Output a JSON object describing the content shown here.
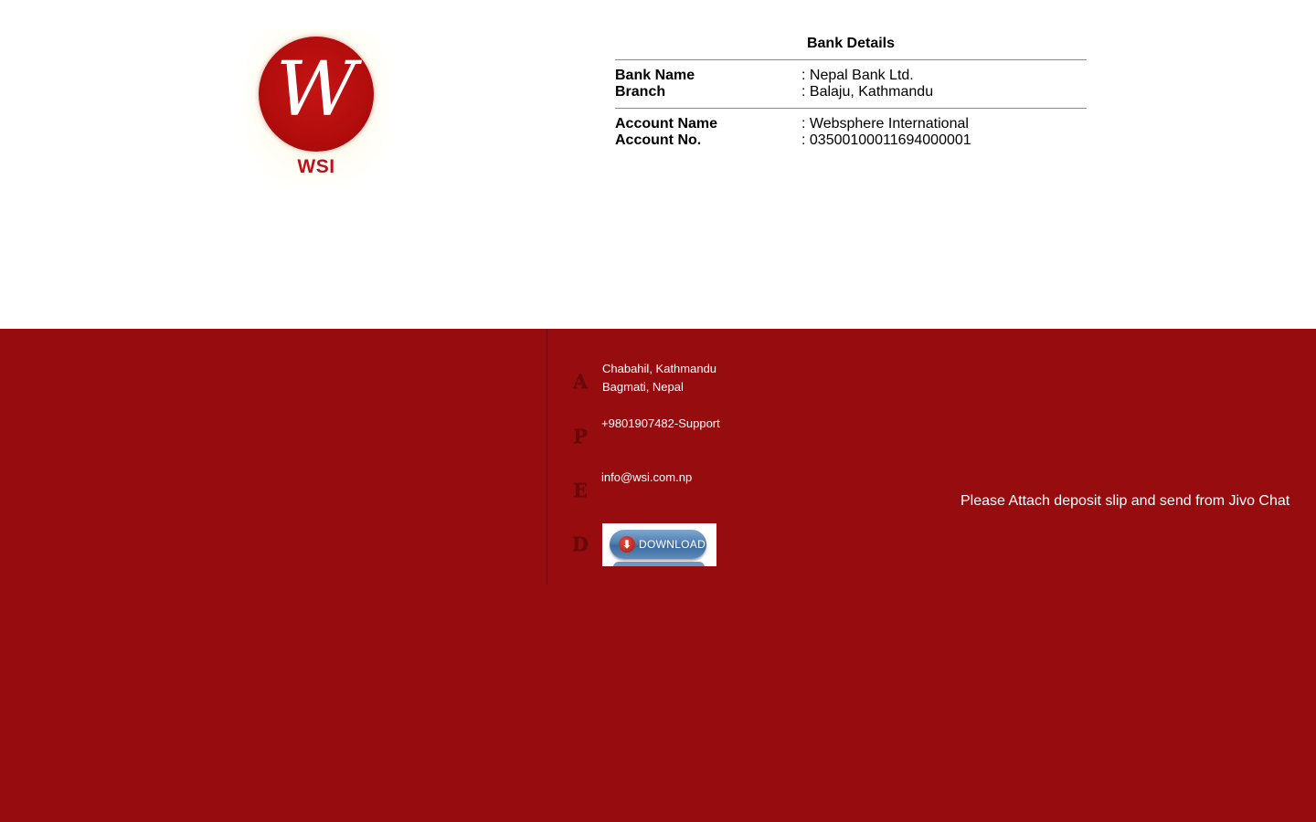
{
  "logo": {
    "letter": "W",
    "text": "WSI"
  },
  "bank": {
    "title": "Bank Details",
    "rows_group1": [
      {
        "label": "Bank Name",
        "value": ": Nepal Bank Ltd."
      },
      {
        "label": "Branch",
        "value": ": Balaju, Kathmandu"
      }
    ],
    "rows_group2": [
      {
        "label": "Account Name",
        "value": ": Websphere International"
      },
      {
        "label": "Account No.",
        "value": ": 03500100011694000001"
      }
    ]
  },
  "footer": {
    "icons": {
      "address": "A",
      "phone": "P",
      "email": "E",
      "download": "D"
    },
    "address_line1": "Chabahil, Kathmandu",
    "address_line2": "Bagmati, Nepal",
    "phone": "+9801907482-Support",
    "email": "info@wsi.com.np",
    "download_label": "DOWNLOAD",
    "download_arrow": "⬇",
    "notice": "Please Attach deposit slip and send from Jivo Chat"
  },
  "colors": {
    "footer_bg": "#970c0f",
    "brand_red": "#b8141b"
  }
}
